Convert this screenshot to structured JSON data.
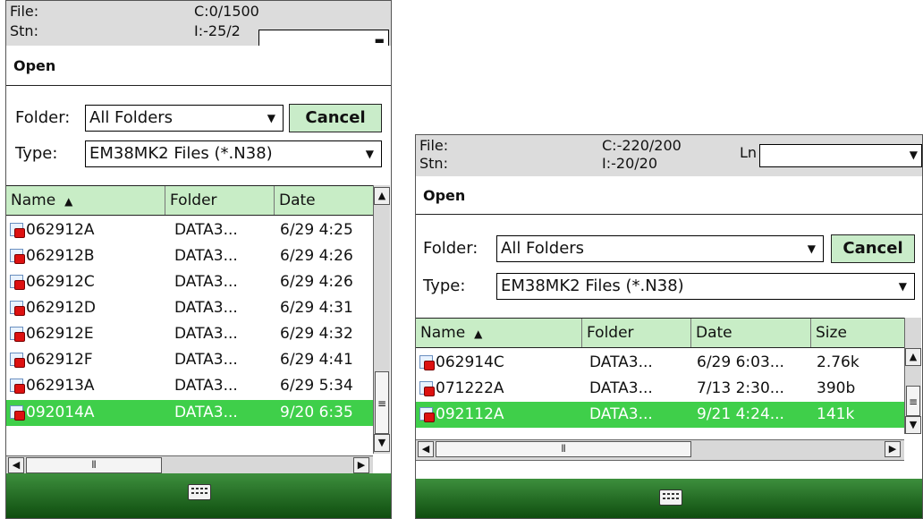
{
  "left": {
    "status": {
      "file_label": "File:",
      "file_value": "C:0/1500",
      "stn_label": "Stn:",
      "stn_value": "I:-25/2"
    },
    "dialog_title": "Open",
    "folder_label": "Folder:",
    "folder_value": "All Folders",
    "cancel_label": "Cancel",
    "type_label": "Type:",
    "type_value": "EM38MK2 Files (*.N38)",
    "columns": {
      "name": "Name",
      "folder": "Folder",
      "date": "Date"
    },
    "files": [
      {
        "name": "062912A",
        "folder": "DATA3...",
        "date": "6/29 4:25"
      },
      {
        "name": "062912B",
        "folder": "DATA3...",
        "date": "6/29 4:26"
      },
      {
        "name": "062912C",
        "folder": "DATA3...",
        "date": "6/29 4:26"
      },
      {
        "name": "062912D",
        "folder": "DATA3...",
        "date": "6/29 4:31"
      },
      {
        "name": "062912E",
        "folder": "DATA3...",
        "date": "6/29 4:32"
      },
      {
        "name": "062912F",
        "folder": "DATA3...",
        "date": "6/29 4:41"
      },
      {
        "name": "062913A",
        "folder": "DATA3...",
        "date": "6/29 5:34"
      },
      {
        "name": "092014A",
        "folder": "DATA3...",
        "date": "9/20 6:35"
      }
    ],
    "selected_file": "092014A"
  },
  "right": {
    "status": {
      "file_label": "File:",
      "file_value": "C:-220/200",
      "stn_label": "Stn:",
      "stn_value": "I:-20/20",
      "ln_label": "Ln"
    },
    "dialog_title": "Open",
    "folder_label": "Folder:",
    "folder_value": "All Folders",
    "cancel_label": "Cancel",
    "type_label": "Type:",
    "type_value": "EM38MK2 Files (*.N38)",
    "columns": {
      "name": "Name",
      "folder": "Folder",
      "date": "Date",
      "size": "Size"
    },
    "files": [
      {
        "name": "062914C",
        "folder": "DATA3...",
        "date": "6/29 6:03...",
        "size": "2.76k"
      },
      {
        "name": "071222A",
        "folder": "DATA3...",
        "date": "7/13 2:30...",
        "size": "390b"
      },
      {
        "name": "092112A",
        "folder": "DATA3...",
        "date": "9/21 4:24...",
        "size": "141k"
      }
    ],
    "selected_file": "092112A"
  },
  "icons": {
    "sort": "sort-ascending-icon",
    "dropdown": "chevron-down-icon",
    "file": "n38-file-icon",
    "keyboard": "keyboard-icon"
  },
  "colors": {
    "selection": "#3fcf4a",
    "header_bg": "#c8edc6",
    "cancel_bg": "#c9ecc9",
    "bar_top": "#3d8f3d",
    "bar_bottom": "#0f4d0f"
  }
}
